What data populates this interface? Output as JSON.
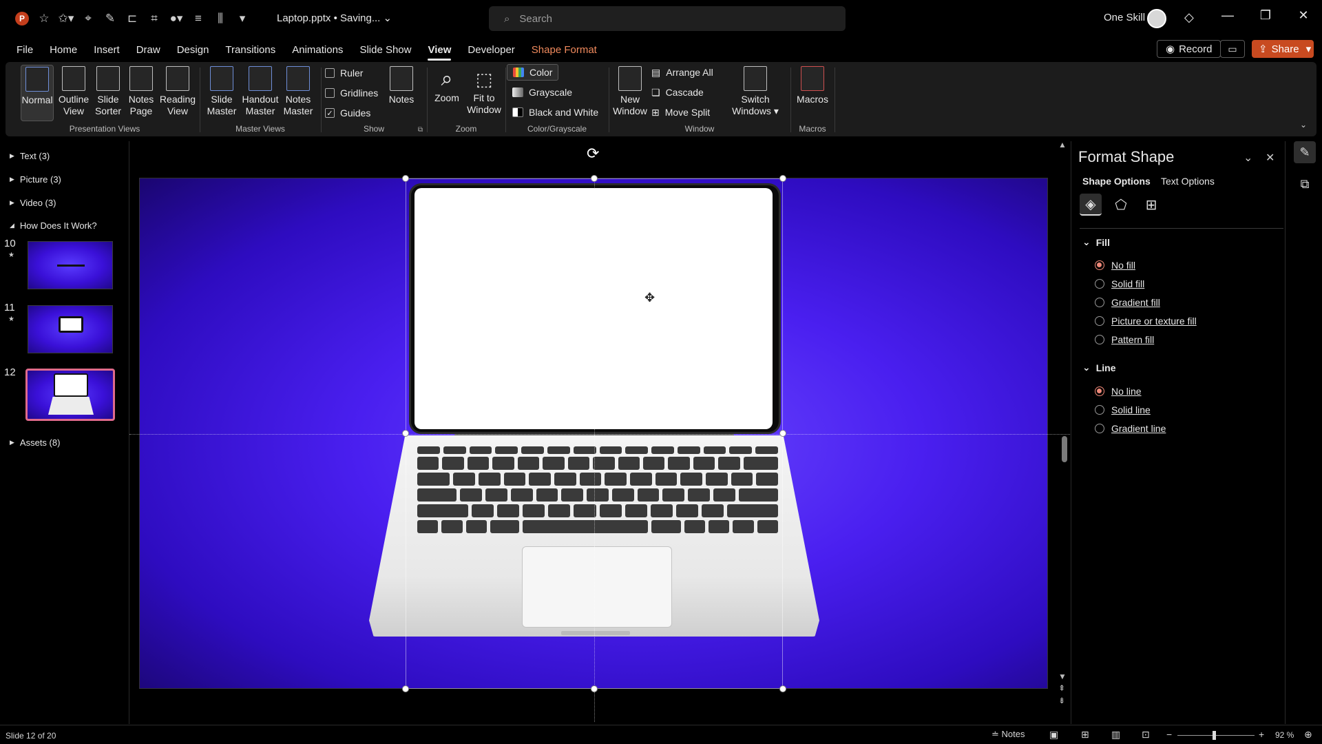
{
  "titlebar": {
    "logo": "P",
    "doc_title": "Laptop.pptx • Saving...",
    "search_placeholder": "Search",
    "user_name": "One Skill"
  },
  "tabs": [
    "File",
    "Home",
    "Insert",
    "Draw",
    "Design",
    "Transitions",
    "Animations",
    "Slide Show",
    "View",
    "Developer",
    "Shape Format"
  ],
  "active_tab": "View",
  "actions": {
    "record": "Record",
    "share": "Share"
  },
  "ribbon": {
    "presentation_views": {
      "label": "Presentation Views",
      "buttons": [
        {
          "line1": "Normal",
          "line2": ""
        },
        {
          "line1": "Outline",
          "line2": "View"
        },
        {
          "line1": "Slide",
          "line2": "Sorter"
        },
        {
          "line1": "Notes",
          "line2": "Page"
        },
        {
          "line1": "Reading",
          "line2": "View"
        }
      ]
    },
    "master_views": {
      "label": "Master Views",
      "buttons": [
        {
          "line1": "Slide",
          "line2": "Master"
        },
        {
          "line1": "Handout",
          "line2": "Master"
        },
        {
          "line1": "Notes",
          "line2": "Master"
        }
      ]
    },
    "show": {
      "label": "Show",
      "ruler": "Ruler",
      "gridlines": "Gridlines",
      "guides": "Guides",
      "notes": "Notes",
      "ruler_checked": false,
      "gridlines_checked": false,
      "guides_checked": true
    },
    "zoom": {
      "label": "Zoom",
      "zoom": "Zoom",
      "fit1": "Fit to",
      "fit2": "Window"
    },
    "color": {
      "label": "Color/Grayscale",
      "color": "Color",
      "grayscale": "Grayscale",
      "bw": "Black and White"
    },
    "window": {
      "label": "Window",
      "new1": "New",
      "new2": "Window",
      "arrange": "Arrange All",
      "cascade": "Cascade",
      "move_split": "Move Split",
      "switch1": "Switch",
      "switch2": "Windows"
    },
    "macros": {
      "label": "Macros",
      "macros": "Macros"
    }
  },
  "left_panel": {
    "sections": [
      {
        "label": "Text (3)",
        "expanded": false
      },
      {
        "label": "Picture (3)",
        "expanded": false
      },
      {
        "label": "Video (3)",
        "expanded": false
      },
      {
        "label": "How Does It Work?",
        "expanded": true
      },
      {
        "label": "Assets (8)",
        "expanded": false
      }
    ],
    "slides": [
      {
        "num": "10",
        "star": "★"
      },
      {
        "num": "11",
        "star": "★"
      },
      {
        "num": "12",
        "star": ""
      }
    ],
    "selected_slide": "12"
  },
  "format_pane": {
    "title": "Format Shape",
    "subtabs": [
      "Shape Options",
      "Text Options"
    ],
    "fill": {
      "header": "Fill",
      "options": [
        "No fill",
        "Solid fill",
        "Gradient fill",
        "Picture or texture fill",
        "Pattern fill"
      ],
      "selected": "No fill"
    },
    "line": {
      "header": "Line",
      "options": [
        "No line",
        "Solid line",
        "Gradient line"
      ],
      "selected": "No line"
    }
  },
  "statusbar": {
    "slide_info": "Slide 12 of 20",
    "notes": "Notes",
    "zoom": "92 %"
  },
  "colors": {
    "accent": "#c84a20",
    "shape_format": "#f08a5d",
    "radio_on": "#f08a7a",
    "slide_bg": "#4a1ff0"
  }
}
